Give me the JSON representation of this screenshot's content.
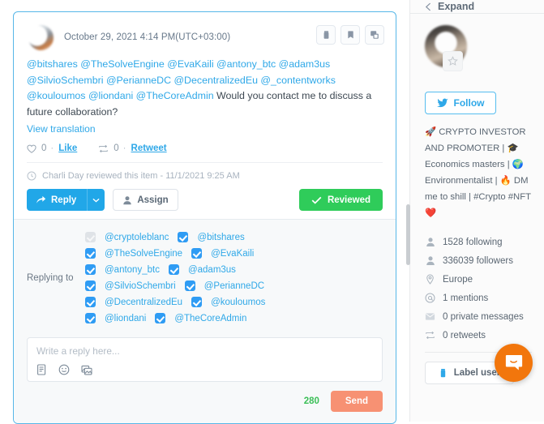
{
  "tweet": {
    "date": "October 29, 2021 4:14 PM(UTC+03:00)",
    "text_mentions": "@bitshares @TheSolveEngine @EvaKaili @antony_btc @adam3us @SilvioSchembri @PerianneDC @DecentralizedEu @_contentworks @kouloumos @liondani @TheCoreAdmin",
    "text_body": " Would you contact me to discuss a future collaboration?",
    "view_translation": "View translation",
    "actions": {
      "label_icon": "tag-icon",
      "bookmark_icon": "bookmark-icon",
      "popout_icon": "popout-icon"
    },
    "engagement": {
      "like_icon": "heart-icon",
      "like_count": "0",
      "like_separator": "·",
      "like_label": "Like",
      "retweet_icon": "retweet-icon",
      "retweet_count": "0",
      "retweet_separator": "·",
      "retweet_label": "Retweet"
    },
    "review_note": {
      "icon": "clock-icon",
      "text": "Charli Day reviewed this item - 11/1/2021 9:25 AM"
    },
    "buttons": {
      "reply": "Reply",
      "reply_caret_icon": "chevron-down-icon",
      "assign": "Assign",
      "assign_icon": "user-icon",
      "reviewed": "Reviewed",
      "reviewed_icon": "check-icon"
    }
  },
  "reply_panel": {
    "replying_to_label": "Replying to",
    "recipients": [
      {
        "left_checked": true,
        "left_disabled": true,
        "left_handle": "@cryptoleblanc",
        "right_checked": true,
        "right_handle": "@bitshares"
      },
      {
        "left_checked": true,
        "left_disabled": false,
        "left_handle": "@TheSolveEngine",
        "right_checked": true,
        "right_handle": "@EvaKaili"
      },
      {
        "left_checked": true,
        "left_disabled": false,
        "left_handle": "@antony_btc",
        "right_checked": true,
        "right_handle": "@adam3us"
      },
      {
        "left_checked": true,
        "left_disabled": false,
        "left_handle": "@SilvioSchembri",
        "right_checked": true,
        "right_handle": "@PerianneDC"
      },
      {
        "left_checked": true,
        "left_disabled": false,
        "left_handle": "@DecentralizedEu",
        "right_checked": true,
        "right_handle": "@kouloumos"
      },
      {
        "left_checked": true,
        "left_disabled": false,
        "left_handle": "@liondani",
        "right_checked": true,
        "right_handle": "@TheCoreAdmin"
      }
    ],
    "composer": {
      "placeholder": "Write a reply here...",
      "value": "",
      "tools": [
        "template-icon",
        "emoji-icon",
        "image-icon"
      ]
    },
    "char_counter": "280",
    "send_label": "Send"
  },
  "sidebar": {
    "expand_label": "Expand",
    "expand_icon": "chevron-left-icon",
    "avatar": "user-avatar",
    "star_badge_icon": "star-icon",
    "follow_label": "Follow",
    "follow_icon": "twitter-bird-icon",
    "bio": "🚀 CRYPTO INVESTOR AND PROMOTER | 🎓 Economics masters | 🌍 Environmentalist | 🔥 DM me to shill | #Crypto #NFT ❤️",
    "stats": [
      {
        "icon": "person-icon",
        "text": "1528 following"
      },
      {
        "icon": "person-icon",
        "text": "336039 followers"
      },
      {
        "icon": "location-pin-icon",
        "text": "Europe"
      },
      {
        "icon": "at-icon",
        "text": "1 mentions"
      },
      {
        "icon": "envelope-icon",
        "text": "0 private messages"
      },
      {
        "icon": "retweet-icon",
        "text": "0 retweets"
      }
    ],
    "label_user": "Label user",
    "label_user_icon": "tag-icon"
  },
  "intercom": {
    "icon": "chat-bubble-icon"
  },
  "colors": {
    "twitter_blue": "#21a7e8",
    "link_blue": "#2fa8e8",
    "green": "#2fcc5a",
    "counter_green": "#3bbf57",
    "send_salmon": "#f79173",
    "checkbox_blue": "#2f9cf4",
    "intercom_orange": "#f2760c",
    "card_border": "#57b7e8"
  }
}
